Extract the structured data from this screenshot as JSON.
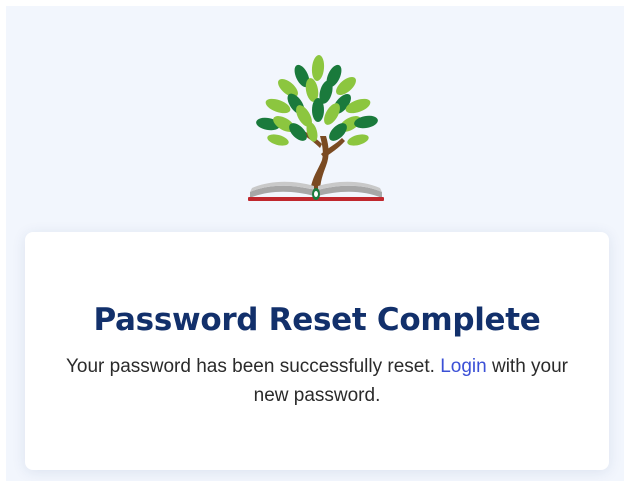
{
  "logo": {
    "icon": "tree-on-open-book-logo",
    "colors": {
      "leaf_light": "#8cc63f",
      "leaf_dark": "#1a7a3c",
      "trunk": "#7a4a22",
      "book_pages": "#9a9a9a",
      "book_cover": "#c0272d"
    }
  },
  "card": {
    "title": "Password Reset Complete",
    "message_before": "Your password has been successfully reset. ",
    "login_link": "Login",
    "message_after": " with your new password."
  },
  "colors": {
    "page_background": "#f2f6fd",
    "card_background": "#ffffff",
    "title": "#12306b",
    "link": "#3b50d6",
    "body_text": "#2b2b2b"
  }
}
